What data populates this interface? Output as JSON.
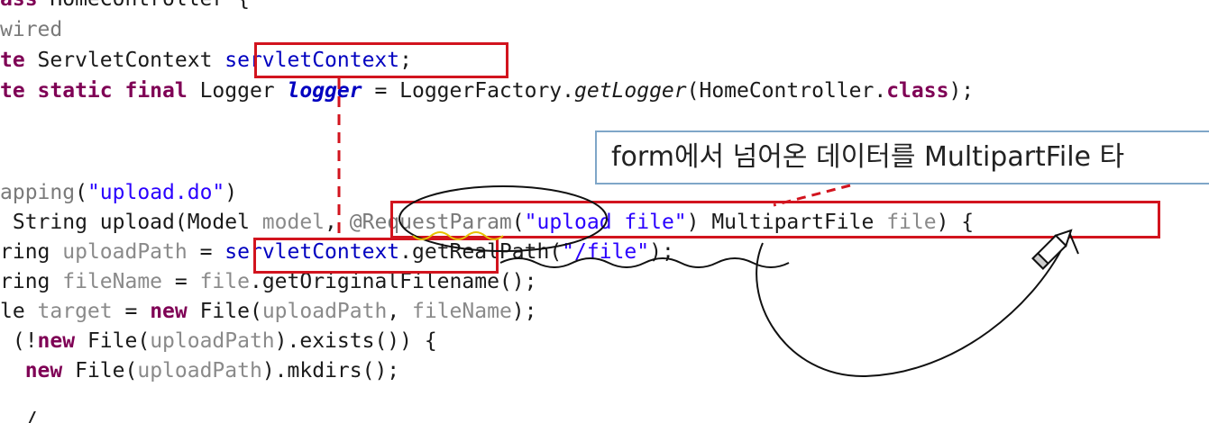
{
  "code": {
    "line1": {
      "kw": "ass",
      "rest": " HomeController {"
    },
    "line2": {
      "ann": "wired"
    },
    "line3": {
      "kw": "te",
      "type": " ServletContext ",
      "field": "servletContext",
      "semi": ";"
    },
    "line4": {
      "kw": "te static final",
      "type": " Logger ",
      "field": "logger",
      "eq": " = LoggerFactory.",
      "method": "getLogger",
      "arg": "(HomeController.",
      "kw2": "class",
      "end": ");"
    },
    "line5": {
      "ann": "apping",
      "open": "(",
      "str": "\"upload.do\"",
      "close": ")"
    },
    "line6": {
      "pre": " String upload(Model ",
      "param": "model",
      "comma": ", ",
      "ann": "@RequestParam",
      "open": "(",
      "str": "\"upload file\"",
      "mid": ") MultipartFile ",
      "param2": "file",
      "end": ") {"
    },
    "line7": {
      "pre": "ring ",
      "var": "uploadPath",
      "eq": " = ",
      "field": "servletContext",
      "call": ".getRealPath(",
      "str": "\"/file\"",
      "end": ");"
    },
    "line8": {
      "pre": "ring ",
      "var": "fileName",
      "eq": " = ",
      "var2": "file",
      "call": ".getOriginalFilename();"
    },
    "line9": {
      "pre": "le ",
      "var": "target",
      "eq": " = ",
      "kw": "new",
      "mid": " File(",
      "var2": "uploadPath",
      "comma": ", ",
      "var3": "fileName",
      "end": ");"
    },
    "line10": {
      "pre": " (!",
      "kw": "new",
      "mid": " File(",
      "var": "uploadPath",
      "end": ").exists()) {"
    },
    "line11": {
      "pre": "  ",
      "kw": "new",
      "mid": " File(",
      "var": "uploadPath",
      "end": ").mkdirs();"
    },
    "line12": {
      "text": "  /"
    }
  },
  "tooltip": {
    "text": "form에서 넘어온 데이터를 MultipartFile 타"
  },
  "colors": {
    "keyword": "#7f0055",
    "field": "#0000c0",
    "string": "#2a00ff",
    "annotation": "#7a7a7a",
    "highlight_box": "#d2141e",
    "tooltip_border": "#7fa6c8"
  }
}
